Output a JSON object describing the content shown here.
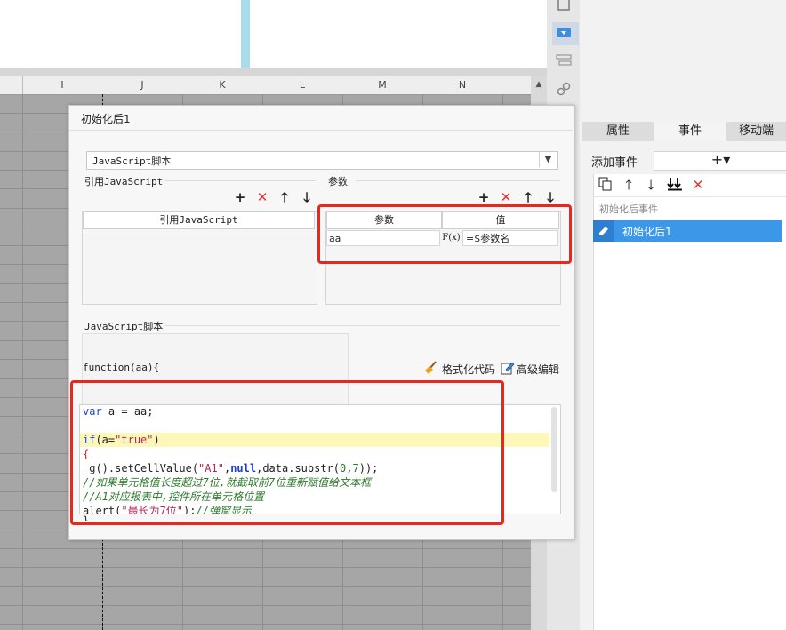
{
  "spreadsheet": {
    "columns": [
      "I",
      "J",
      "K",
      "L",
      "M",
      "N"
    ]
  },
  "right_panel": {
    "tabs": [
      "属性",
      "事件",
      "移动端"
    ],
    "add_event_label": "添加事件",
    "add_event_symbol": "+▾",
    "event_group": "初始化后事件",
    "event_item": "初始化后1"
  },
  "dialog": {
    "title": "初始化后1",
    "script_type": "JavaScript脚本",
    "ref_js_section": "引用JavaScript",
    "ref_js_header": "引用JavaScript",
    "params_section": "参数",
    "params_header_name": "参数",
    "params_header_value": "值",
    "param_row": {
      "name": "aa",
      "formula_icon": "F(x)",
      "value": "=$参数名"
    },
    "script_section": "JavaScript脚本",
    "function_sig": "function(aa){",
    "format_code_label": "格式化代码",
    "advanced_edit_label": "高级编辑",
    "code_lines": [
      "var a = aa;",
      "",
      "if(a=\"true\")",
      "{",
      "_g().setCellValue(\"A1\",null,data.substr(0,7));",
      "//如果单元格值长度超过7位,就截取前7位重新赋值给文本框",
      "//A1对应报表中,控件所在单元格位置",
      "alert(\"最长为7位\");//弹窗显示",
      "}"
    ]
  },
  "colors": {
    "highlight_frame": "#e8281c",
    "selected_event": "#3d97e8"
  }
}
